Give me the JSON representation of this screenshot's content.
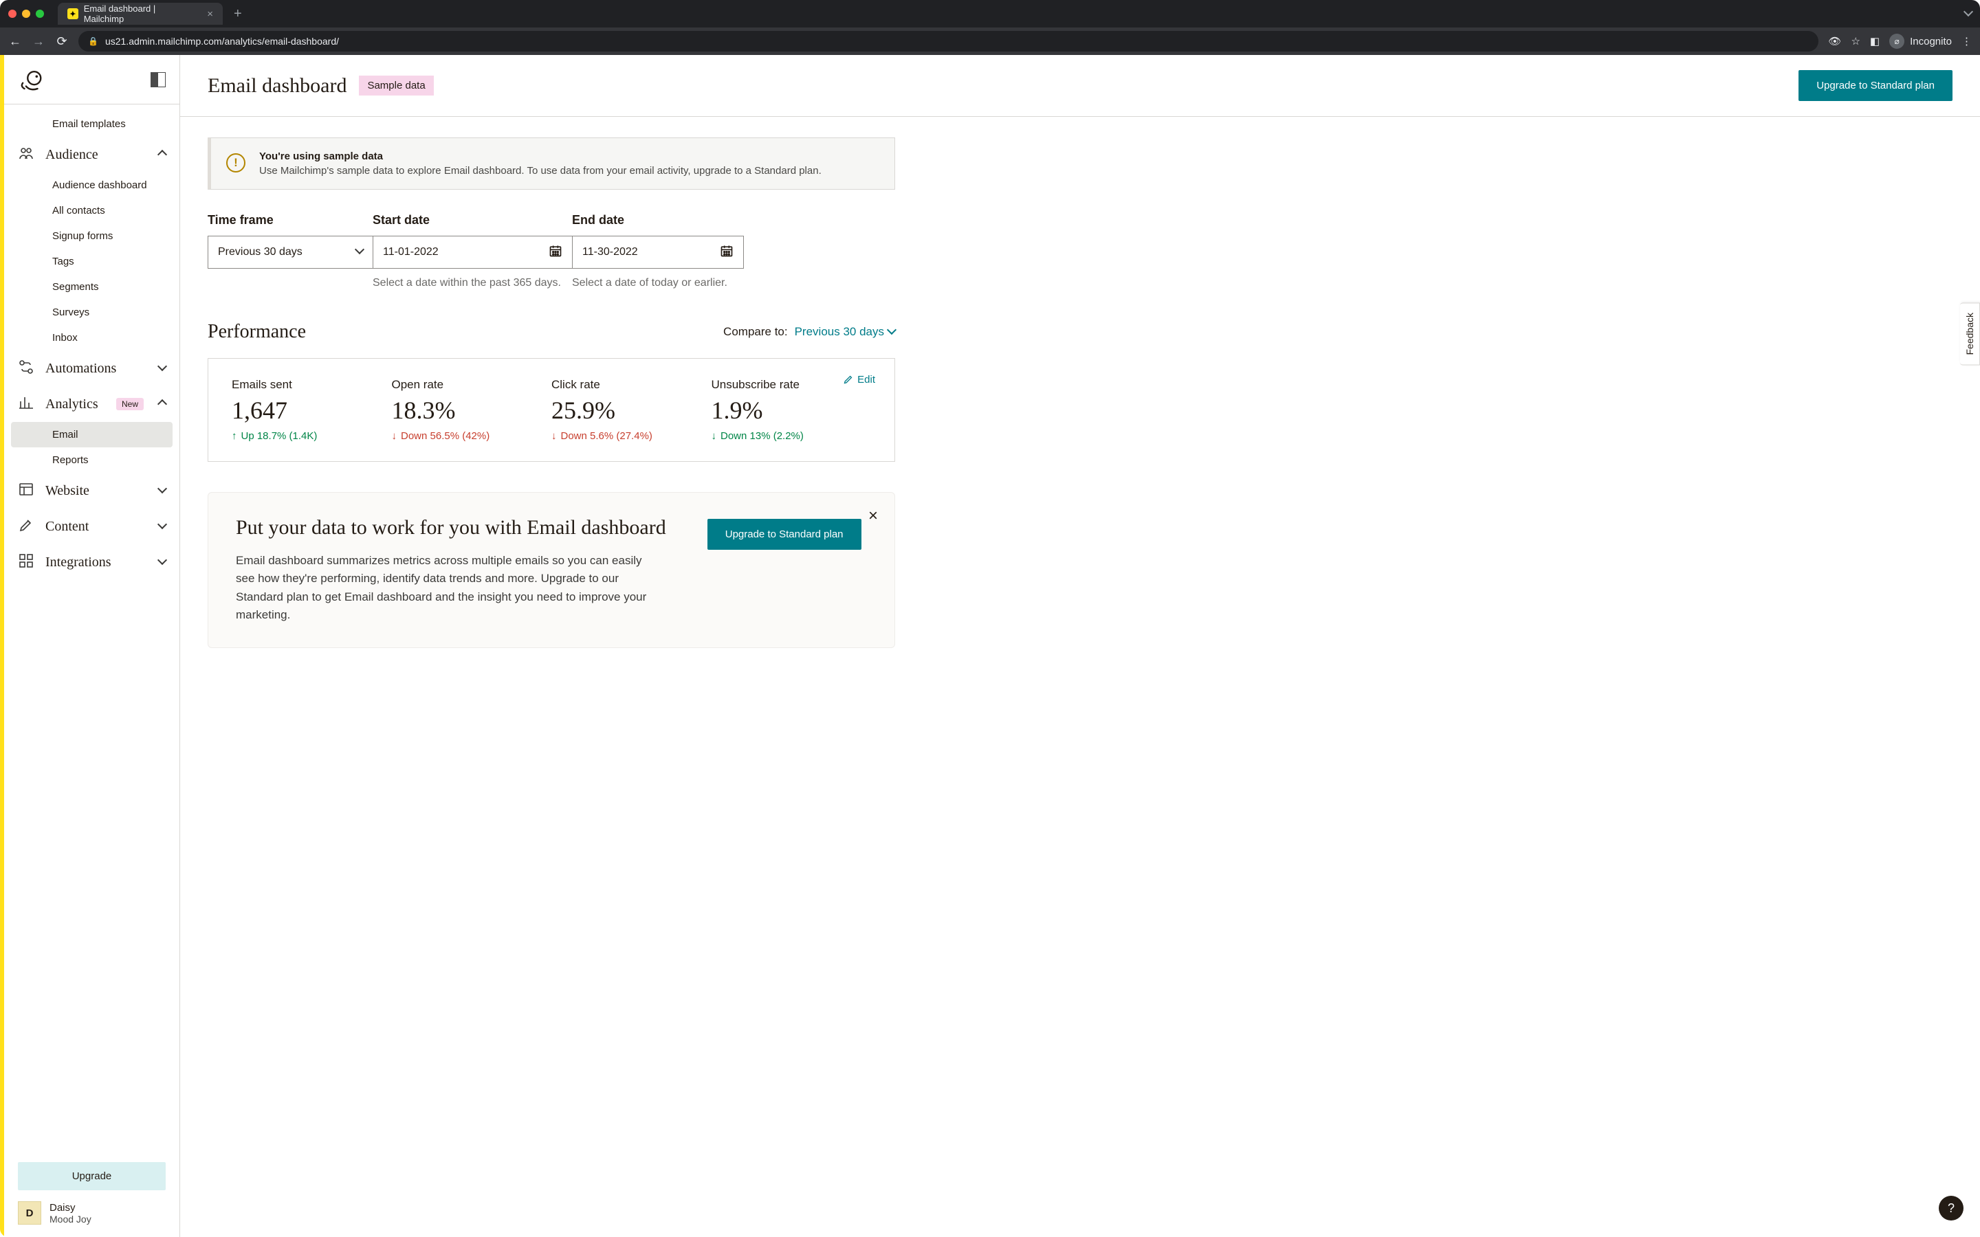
{
  "browser": {
    "tab_title": "Email dashboard | Mailchimp",
    "url": "us21.admin.mailchimp.com/analytics/email-dashboard/",
    "incognito_label": "Incognito"
  },
  "sidebar": {
    "items_top_sub": "Email templates",
    "audience": {
      "label": "Audience",
      "children": [
        "Audience dashboard",
        "All contacts",
        "Signup forms",
        "Tags",
        "Segments",
        "Surveys",
        "Inbox"
      ]
    },
    "automations": {
      "label": "Automations"
    },
    "analytics": {
      "label": "Analytics",
      "new_badge": "New",
      "children": [
        "Email",
        "Reports"
      ],
      "active_child": "Email"
    },
    "website": {
      "label": "Website"
    },
    "content": {
      "label": "Content"
    },
    "integrations": {
      "label": "Integrations"
    },
    "upgrade_btn": "Upgrade",
    "user": {
      "initial": "D",
      "name": "Daisy",
      "org": "Mood Joy"
    }
  },
  "header": {
    "title": "Email dashboard",
    "sample_badge": "Sample data",
    "upgrade_btn": "Upgrade to Standard plan"
  },
  "notice": {
    "title": "You're using sample data",
    "body": "Use Mailchimp's sample data to explore Email dashboard. To use data from your email activity, upgrade to a Standard plan."
  },
  "filters": {
    "timeframe_label": "Time frame",
    "timeframe_value": "Previous 30 days",
    "start_label": "Start date",
    "start_value": "11-01-2022",
    "start_helper": "Select a date within the past 365 days.",
    "end_label": "End date",
    "end_value": "11-30-2022",
    "end_helper": "Select a date of today or earlier."
  },
  "performance": {
    "title": "Performance",
    "compare_label": "Compare to:",
    "compare_value": "Previous 30 days",
    "edit": "Edit",
    "stats": [
      {
        "label": "Emails sent",
        "value": "1,647",
        "delta": "Up 18.7% (1.4K)",
        "dir": "up",
        "tone": "green"
      },
      {
        "label": "Open rate",
        "value": "18.3%",
        "delta": "Down 56.5% (42%)",
        "dir": "down",
        "tone": "red"
      },
      {
        "label": "Click rate",
        "value": "25.9%",
        "delta": "Down 5.6% (27.4%)",
        "dir": "down",
        "tone": "red"
      },
      {
        "label": "Unsubscribe rate",
        "value": "1.9%",
        "delta": "Down 13% (2.2%)",
        "dir": "down",
        "tone": "green"
      }
    ]
  },
  "promo": {
    "title": "Put your data to work for you with Email dashboard",
    "body": "Email dashboard summarizes metrics across multiple emails so you can easily see how they're performing, identify data trends and more. Upgrade to our Standard plan to get Email dashboard and the insight you need to improve your marketing.",
    "cta": "Upgrade to Standard plan"
  },
  "misc": {
    "feedback": "Feedback",
    "help": "?"
  }
}
